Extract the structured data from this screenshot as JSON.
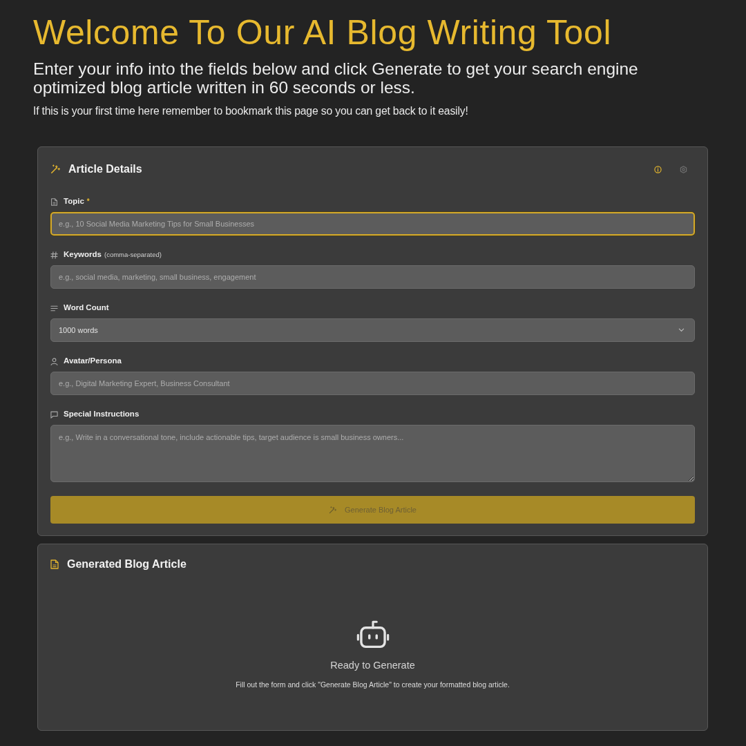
{
  "header": {
    "title": "Welcome To Our AI Blog Writing Tool",
    "subtitle": "Enter your info into the fields below and click Generate to get your search engine optimized blog article written in 60 seconds or less.",
    "note": "If this is your first time here remember to bookmark this page so you can get back to it easily!"
  },
  "form": {
    "title": "Article Details",
    "fields": [
      {
        "kind": "text",
        "label": "Topic",
        "required_mark": "*",
        "placeholder": "e.g., 10 Social Media Marketing Tips for Small Businesses",
        "focused": true
      },
      {
        "kind": "text",
        "label": "Keywords",
        "hint": "(comma-separated)",
        "placeholder": "e.g., social media, marketing, small business, engagement",
        "focused": false
      },
      {
        "kind": "select",
        "label": "Word Count",
        "value": "1000 words",
        "focused": false
      },
      {
        "kind": "text",
        "label": "Avatar/Persona",
        "placeholder": "e.g., Digital Marketing Expert, Business Consultant",
        "focused": false
      },
      {
        "kind": "textarea",
        "label": "Special Instructions",
        "placeholder": "e.g., Write in a conversational tone, include actionable tips, target audience is small business owners...",
        "focused": false
      }
    ],
    "button": {
      "label": "Generate Blog Article",
      "disabled": true
    }
  },
  "output": {
    "title": "Generated Blog Article",
    "empty_state": {
      "title": "Ready to Generate",
      "text": "Fill out the form and click \"Generate Blog Article\" to create your formatted blog article."
    }
  }
}
